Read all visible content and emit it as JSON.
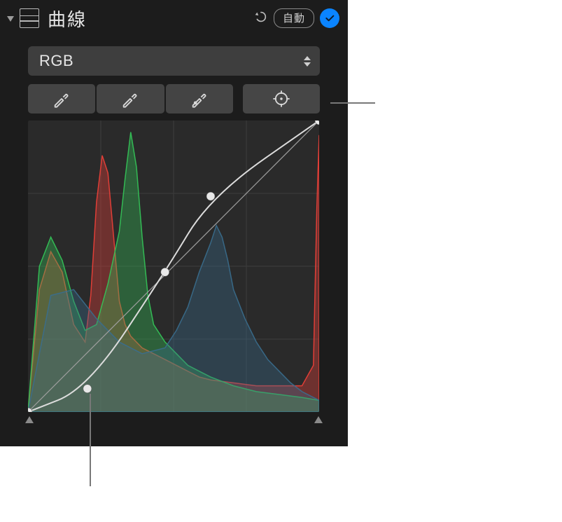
{
  "header": {
    "title": "曲線",
    "auto_label": "自動"
  },
  "channel": {
    "selected": "RGB"
  },
  "tools": {
    "eyedropper_black": "black-point-eyedropper",
    "eyedropper_gray": "gray-point-eyedropper",
    "eyedropper_white": "white-point-eyedropper",
    "add_point": "add-point-target"
  },
  "chart_data": {
    "type": "line",
    "title": "",
    "xlabel": "",
    "ylabel": "",
    "xlim": [
      0,
      255
    ],
    "ylim": [
      0,
      100
    ],
    "grid": true,
    "series": [
      {
        "name": "red-histogram",
        "color": "#ef4038",
        "x": [
          0,
          10,
          20,
          30,
          40,
          50,
          55,
          60,
          65,
          70,
          75,
          80,
          85,
          90,
          100,
          110,
          120,
          130,
          140,
          150,
          160,
          180,
          200,
          220,
          240,
          250,
          253,
          255
        ],
        "values": [
          0,
          42,
          55,
          48,
          30,
          24,
          40,
          72,
          88,
          82,
          60,
          38,
          30,
          26,
          22,
          20,
          18,
          16,
          14,
          12,
          11,
          10,
          9,
          9,
          9,
          16,
          70,
          95
        ]
      },
      {
        "name": "green-histogram",
        "color": "#34c759",
        "x": [
          0,
          10,
          20,
          30,
          40,
          50,
          60,
          70,
          80,
          85,
          90,
          95,
          100,
          105,
          110,
          120,
          130,
          140,
          150,
          160,
          180,
          200,
          220,
          240,
          255
        ],
        "values": [
          0,
          50,
          60,
          52,
          38,
          28,
          30,
          44,
          62,
          80,
          96,
          84,
          60,
          40,
          30,
          24,
          20,
          16,
          14,
          12,
          9,
          7,
          6,
          5,
          4
        ]
      },
      {
        "name": "blue-histogram",
        "color": "#3a6e8e",
        "x": [
          0,
          20,
          40,
          60,
          80,
          100,
          120,
          130,
          140,
          150,
          160,
          165,
          170,
          175,
          180,
          190,
          200,
          210,
          220,
          230,
          240,
          255
        ],
        "values": [
          0,
          40,
          42,
          32,
          24,
          20,
          22,
          28,
          36,
          48,
          58,
          64,
          60,
          52,
          42,
          32,
          24,
          18,
          14,
          10,
          7,
          4
        ]
      },
      {
        "name": "curve-baseline",
        "color": "#9e9e9e",
        "x": [
          0,
          255
        ],
        "values": [
          0,
          100
        ]
      },
      {
        "name": "curve-adjusted",
        "color": "#dcdcdc",
        "x": [
          0,
          52,
          120,
          160,
          255
        ],
        "values": [
          0,
          8,
          48,
          74,
          100
        ]
      }
    ],
    "control_points": [
      {
        "x": 0,
        "y": 0
      },
      {
        "x": 52,
        "y": 8
      },
      {
        "x": 120,
        "y": 48
      },
      {
        "x": 160,
        "y": 74
      },
      {
        "x": 255,
        "y": 100
      }
    ]
  }
}
